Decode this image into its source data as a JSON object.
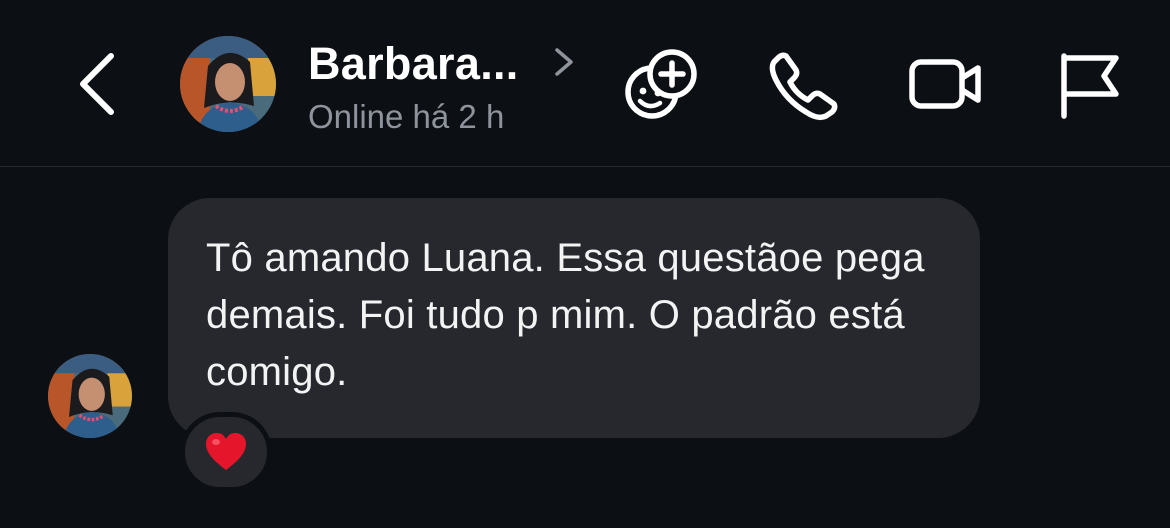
{
  "header": {
    "contact_name": "Barbara...",
    "status": "Online há 2 h"
  },
  "icons": {
    "back": "chevron-left-icon",
    "name_chevron": "chevron-right-icon",
    "games": "games-icon",
    "call": "phone-icon",
    "video": "video-camera-icon",
    "report": "flag-icon",
    "reaction": "heart-icon"
  },
  "message": {
    "text": "Tô amando Luana. Essa questãoe pega demais. Foi tudo p mim. O padrão está comigo.",
    "reaction": "heart"
  },
  "colors": {
    "background": "#0c0f14",
    "bubble": "#26282d",
    "text": "#ffffff",
    "secondary_text": "#8f949c",
    "heart": "#e5162b"
  }
}
